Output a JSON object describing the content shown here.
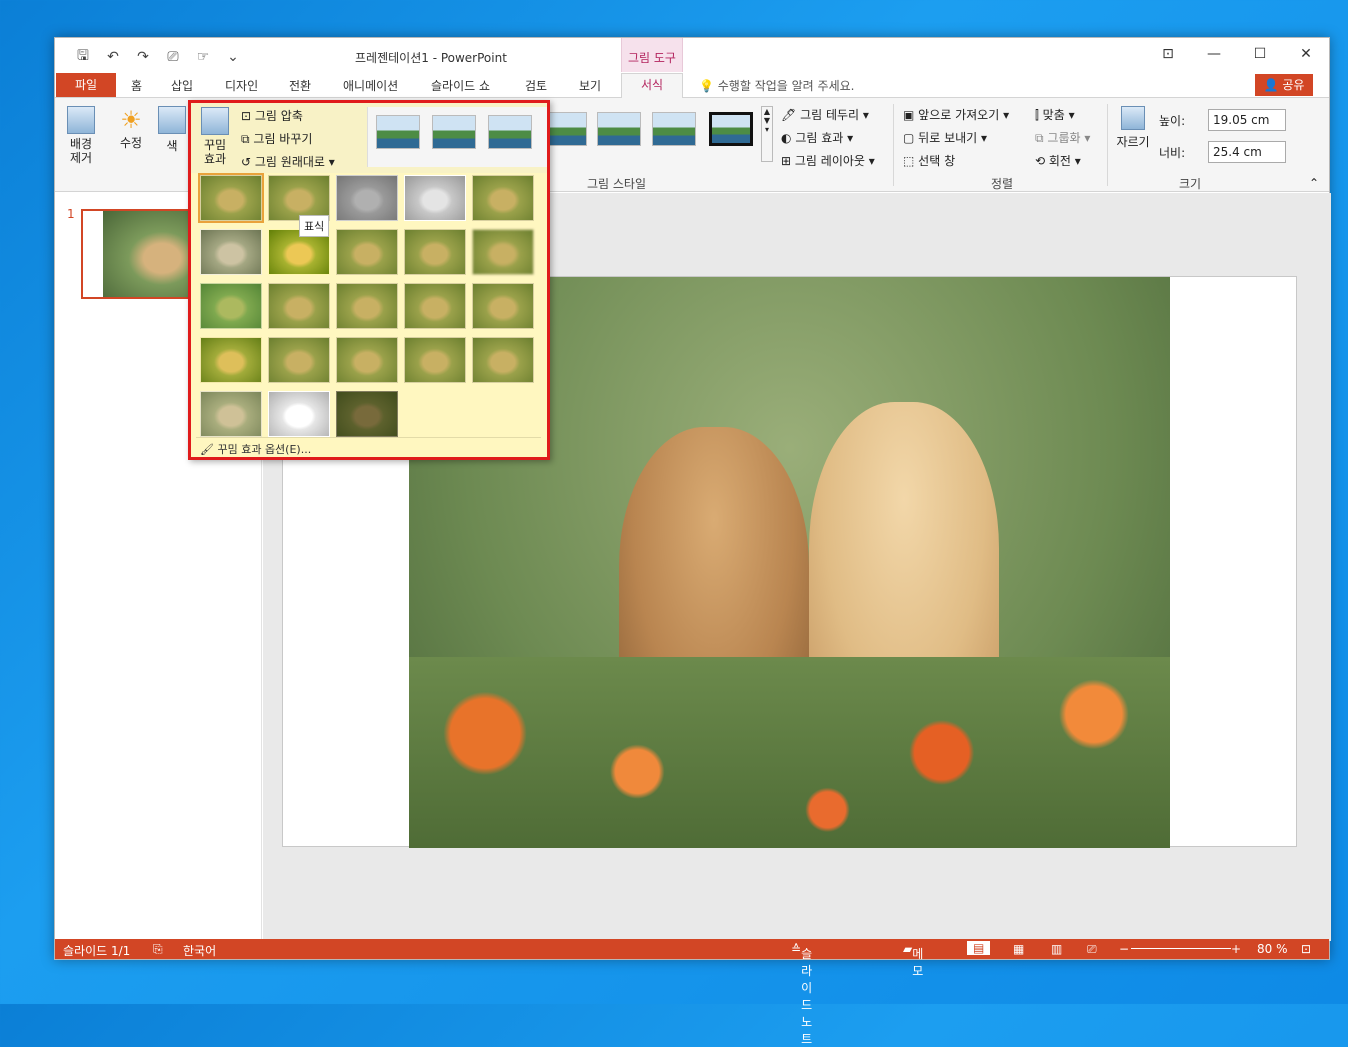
{
  "title": "프레젠테이션1 - PowerPoint",
  "tool_tab": "그림 도구",
  "window_controls": [
    "⊡",
    "—",
    "☐",
    "✕"
  ],
  "qat_icons": [
    "save-icon",
    "undo-icon",
    "redo-icon",
    "presenter-icon",
    "touch-icon",
    "customize-icon"
  ],
  "tabs": [
    "파일",
    "홈",
    "삽입",
    "디자인",
    "전환",
    "애니메이션",
    "슬라이드 쇼",
    "검토",
    "보기",
    "서식"
  ],
  "tell_me": "수행할 작업을 알려 주세요.",
  "share": "공유",
  "ribbon": {
    "remove_bg": "배경\n제거",
    "corrections": "수정",
    "color": "색",
    "artistic": "꾸밈\n효과",
    "compress": "그림 압축",
    "change": "그림 바꾸기",
    "reset": "그림 원래대로",
    "border": "그림 테두리",
    "effects": "그림 효과",
    "layout": "그림 레이아웃",
    "styles_group": "그림 스타일",
    "bring_forward": "앞으로 가져오기",
    "send_backward": "뒤로 보내기",
    "selection_pane": "선택 창",
    "align": "맞춤",
    "group": "그룹화",
    "rotate": "회전",
    "arrange_group": "정렬",
    "crop": "자르기",
    "height_label": "높이:",
    "height_value": "19.05 cm",
    "width_label": "너비:",
    "width_value": "25.4 cm",
    "size_group": "크기"
  },
  "dropdown": {
    "tooltip": "표식",
    "options": "꾸밈 효과 옵션(E)..."
  },
  "slide_number": "1",
  "status": {
    "slide": "슬라이드 1/1",
    "language": "한국어",
    "notes": "슬라이드 노트",
    "comments": "메모",
    "zoom": "80 %"
  }
}
